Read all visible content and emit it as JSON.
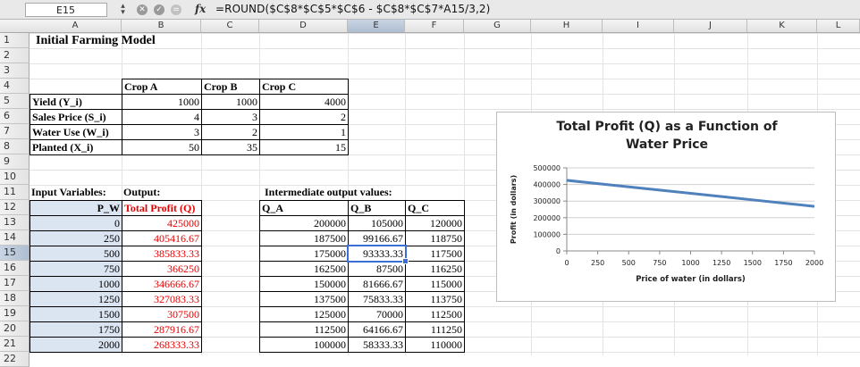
{
  "formula_bar": {
    "name_box": "E15",
    "fx": "fx",
    "formula": "=ROUND($C$8*$C$5*$C$6 - $C$8*$C$7*A15/3,2)"
  },
  "columns": [
    "A",
    "B",
    "C",
    "D",
    "E",
    "F",
    "G",
    "H",
    "I",
    "J",
    "K",
    "L"
  ],
  "rows": [
    "1",
    "2",
    "3",
    "4",
    "5",
    "6",
    "7",
    "8",
    "9",
    "10",
    "11",
    "12",
    "13",
    "14",
    "15",
    "16",
    "17",
    "18",
    "19",
    "20",
    "21",
    "22"
  ],
  "sheet": {
    "title": "Initial Farming Model",
    "crop_headers": [
      "Crop A",
      "Crop B",
      "Crop C"
    ],
    "param_labels": [
      "Yield (Y_i)",
      "Sales Price (S_i)",
      "Water Use (W_i)",
      "Planted (X_i)"
    ],
    "params": [
      [
        "1000",
        "1000",
        "4000"
      ],
      [
        "4",
        "3",
        "2"
      ],
      [
        "3",
        "2",
        "1"
      ],
      [
        "50",
        "35",
        "15"
      ]
    ],
    "input_label": "Input Variables:",
    "output_label": "Output:",
    "intermediate_label": "Intermediate output values:",
    "pw_header": "P_W",
    "profit_header": "Total Profit (Q)",
    "q_headers": [
      "Q_A",
      "Q_B",
      "Q_C"
    ],
    "pw": [
      "0",
      "250",
      "500",
      "750",
      "1000",
      "1250",
      "1500",
      "1750",
      "2000"
    ],
    "profit": [
      "425000",
      "405416.67",
      "385833.33",
      "366250",
      "346666.67",
      "327083.33",
      "307500",
      "287916.67",
      "268333.33"
    ],
    "qa": [
      "200000",
      "187500",
      "175000",
      "162500",
      "150000",
      "137500",
      "125000",
      "112500",
      "100000"
    ],
    "qb": [
      "105000",
      "99166.67",
      "93333.33",
      "87500",
      "81666.67",
      "75833.33",
      "70000",
      "64166.67",
      "58333.33"
    ],
    "qc": [
      "120000",
      "118750",
      "117500",
      "116250",
      "115000",
      "113750",
      "112500",
      "111250",
      "110000"
    ]
  },
  "chart_data": {
    "type": "line",
    "title": "Total Profit (Q) as a Function of Water Price",
    "title_lines": [
      "Total Profit (Q) as a Function of",
      "Water Price"
    ],
    "xlabel": "Price of water (in dollars)",
    "ylabel": "Profit (in dollars)",
    "x": [
      0,
      250,
      500,
      750,
      1000,
      1250,
      1500,
      1750,
      2000
    ],
    "series": [
      {
        "values": [
          425000,
          405416.67,
          385833.33,
          366250,
          346666.67,
          327083.33,
          307500,
          287916.67,
          268333.33
        ],
        "color": "#4f81bd"
      }
    ],
    "xticks": [
      "0",
      "250",
      "500",
      "750",
      "1000",
      "1250",
      "1500",
      "1750",
      "2000"
    ],
    "yticks": [
      "0",
      "100000",
      "200000",
      "300000",
      "400000",
      "500000"
    ],
    "ylim": [
      0,
      500000
    ],
    "xlim": [
      0,
      2000
    ],
    "grid": true,
    "legend": "none"
  }
}
